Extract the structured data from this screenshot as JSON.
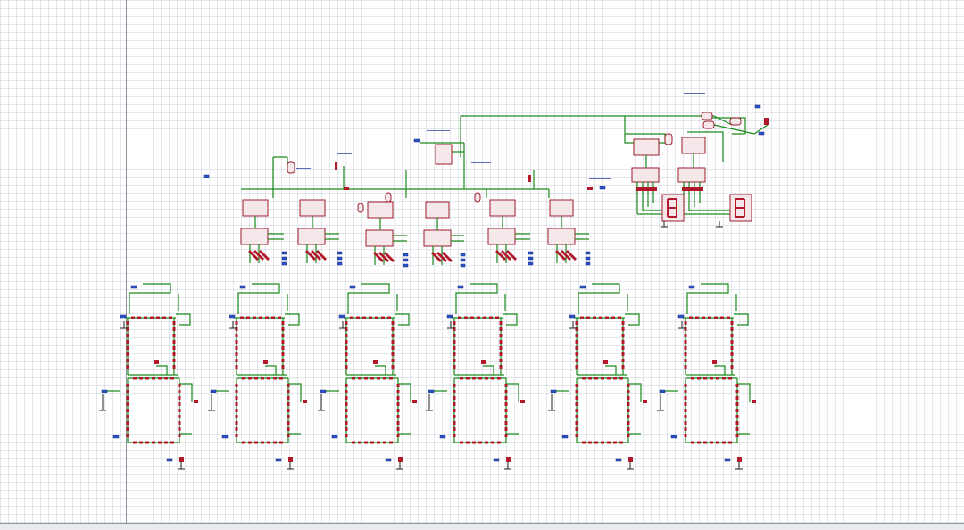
{
  "app": {
    "view": "schematic-canvas",
    "colors": {
      "canvas_background": "#ffffff",
      "grid_line": "#d8dce4",
      "origin_axis": "#8d939c",
      "wire": "#1a8a1a",
      "component": "#9a1b2b",
      "port": "#2b52c8",
      "annotation": "#5a6fb5"
    }
  },
  "schematic": {
    "counter_section": {
      "chip_columns": 6,
      "chips_per_column": 2
    },
    "display_section": {
      "seven_segment_displays": 2,
      "chips": 4
    },
    "led_matrix_section": {
      "blocks": 6,
      "rows_per_block": 2
    }
  }
}
